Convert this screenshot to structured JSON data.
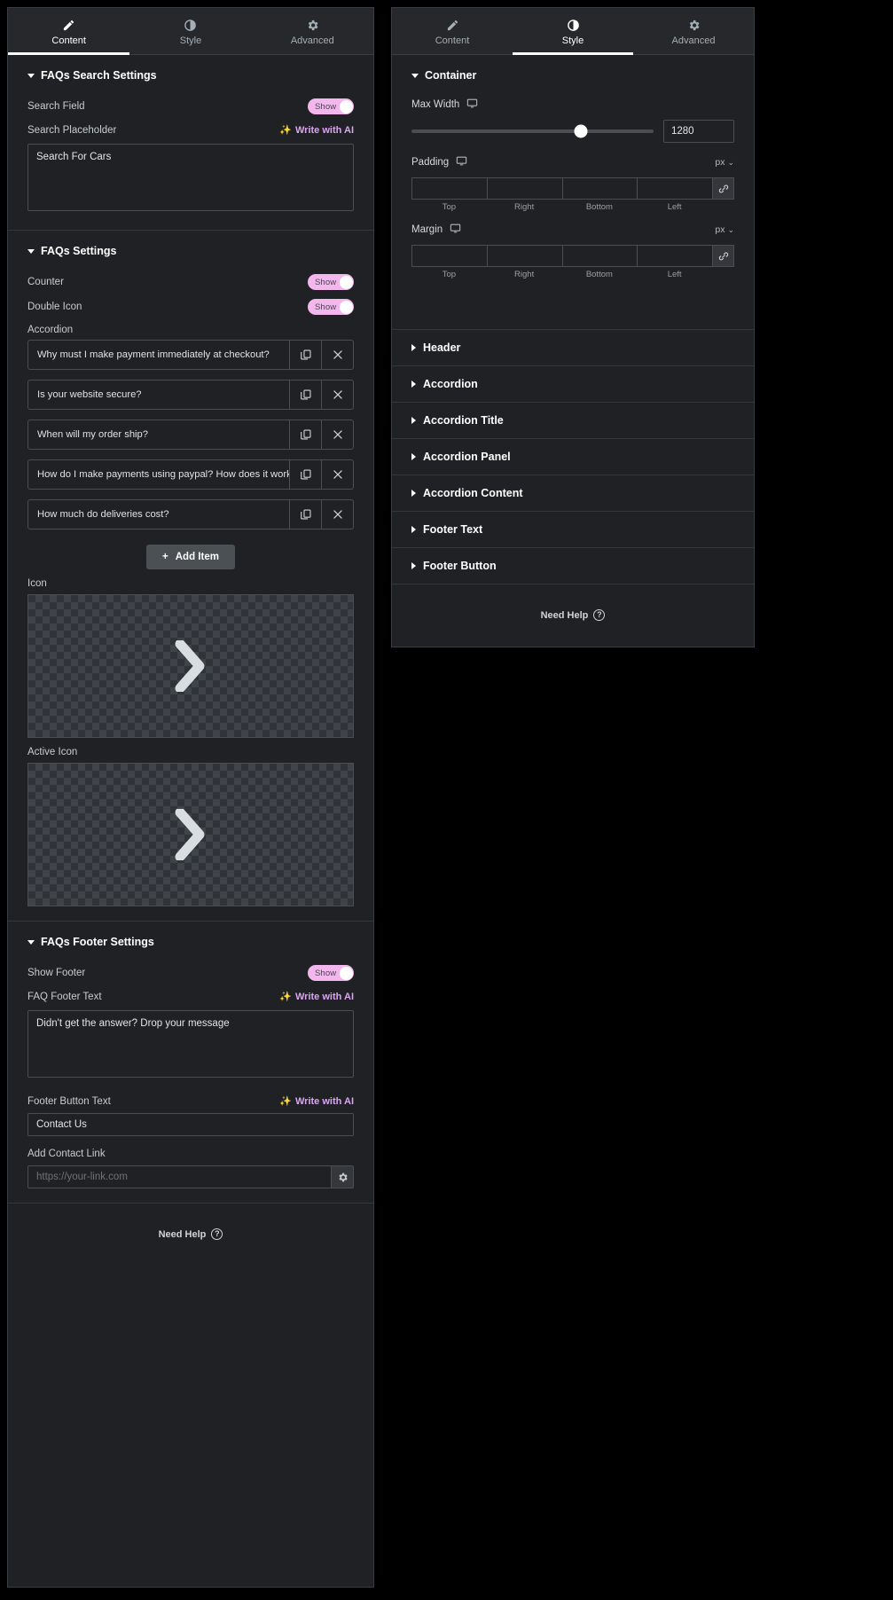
{
  "tabs": {
    "content": {
      "label": "Content",
      "icon": "pencil-icon"
    },
    "style": {
      "label": "Style",
      "icon": "contrast-icon"
    },
    "advanced": {
      "label": "Advanced",
      "icon": "gear-icon"
    }
  },
  "accent": {
    "toggle_pink": "#f4b7ed",
    "ai_purple": "#d9a6f0",
    "active_tab": "#ffffff"
  },
  "content_panel": {
    "active_tab": "Content",
    "search_settings": {
      "title": "FAQs Search Settings",
      "search_field_label": "Search Field",
      "search_field_toggle": "Show",
      "search_placeholder_label": "Search Placeholder",
      "ai_label": "Write with AI",
      "search_placeholder_value": "Search For Cars"
    },
    "faqs_settings": {
      "title": "FAQs Settings",
      "counter_label": "Counter",
      "counter_toggle": "Show",
      "double_icon_label": "Double Icon",
      "double_icon_toggle": "Show",
      "accordion_label": "Accordion",
      "items": [
        "Why must I make payment immediately at checkout?",
        "Is your website secure?",
        "When will my order ship?",
        "How do I make payments using paypal? How does it work?",
        "How much do deliveries cost?"
      ],
      "add_item_label": "Add Item",
      "icon_label": "Icon",
      "icon_glyph": "chevron-right-icon",
      "active_icon_label": "Active Icon",
      "active_icon_glyph": "chevron-right-icon"
    },
    "footer_settings": {
      "title": "FAQs Footer Settings",
      "show_footer_label": "Show Footer",
      "show_footer_toggle": "Show",
      "faq_footer_text_label": "FAQ Footer Text",
      "ai_label": "Write with AI",
      "faq_footer_text_value": "Didn't get the answer? Drop your message",
      "footer_button_text_label": "Footer Button Text",
      "footer_button_text_value": "Contact Us",
      "add_contact_link_label": "Add Contact Link",
      "add_contact_link_placeholder": "https://your-link.com"
    },
    "need_help": "Need Help"
  },
  "style_panel": {
    "active_tab": "Style",
    "container": {
      "title": "Container",
      "max_width_label": "Max Width",
      "max_width_value": "1280",
      "max_width_percent": 70,
      "padding_label": "Padding",
      "padding_unit": "px",
      "margin_label": "Margin",
      "margin_unit": "px",
      "dim_labels": [
        "Top",
        "Right",
        "Bottom",
        "Left"
      ]
    },
    "sections": [
      "Header",
      "Accordion",
      "Accordion Title",
      "Accordion Panel",
      "Accordion Content",
      "Footer Text",
      "Footer Button"
    ],
    "need_help": "Need Help"
  }
}
